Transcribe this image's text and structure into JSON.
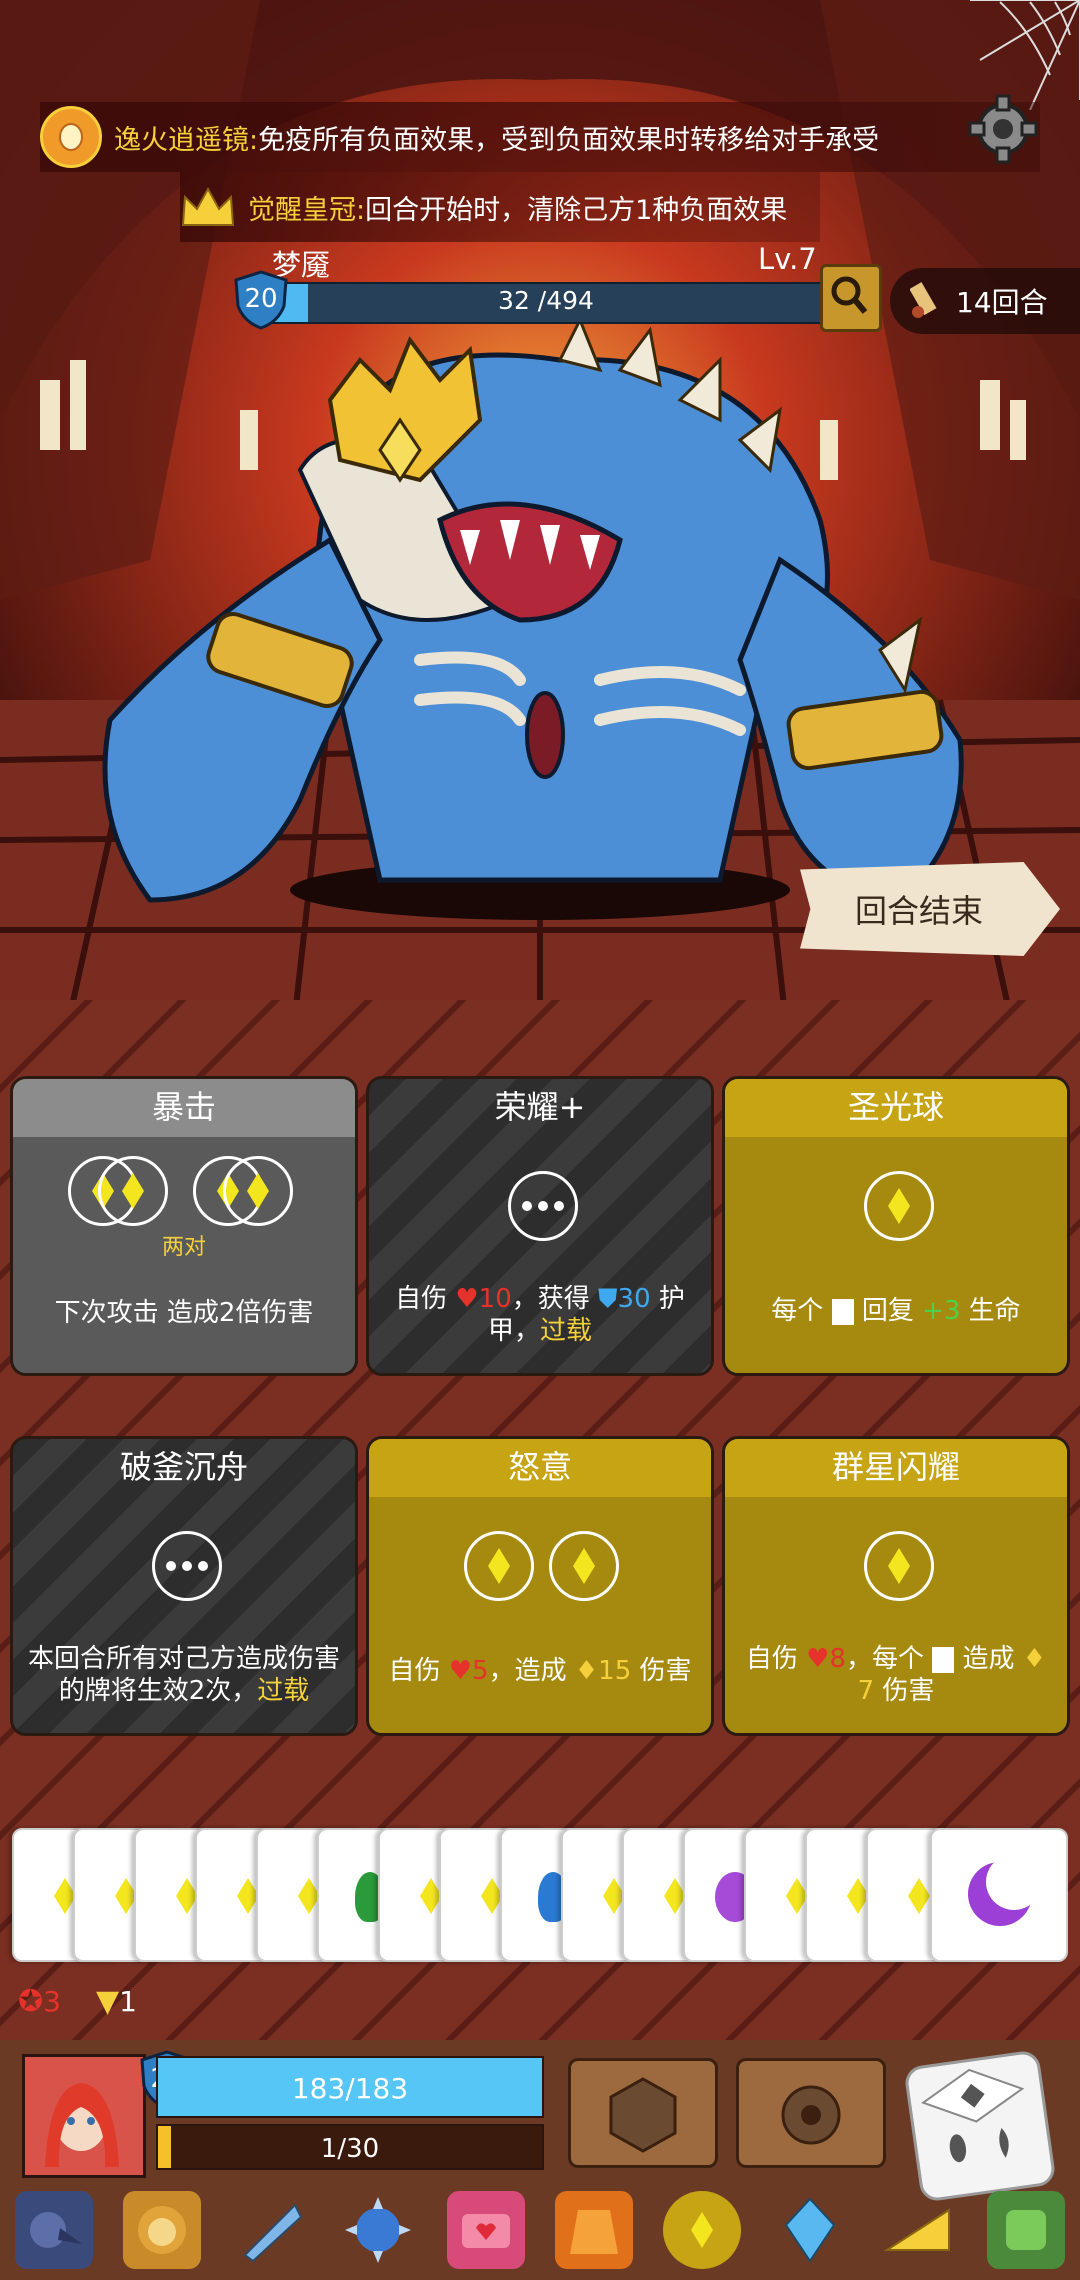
{
  "buffs": [
    {
      "name": "逸火逍遥镜:",
      "desc": "免疫所有负面效果，受到负面效果时转移给对手承受"
    },
    {
      "name": "觉醒皇冠:",
      "desc": "回合开始时，清除己方1种负面效果"
    }
  ],
  "enemy": {
    "name": "梦魇",
    "level": "Lv.7",
    "shield": "20",
    "hp_text": "32 /494",
    "hp_fraction": 0.065
  },
  "turns": "14回合",
  "end_turn_label": "回合结束",
  "cards": [
    {
      "title": "暴击",
      "style": "gray",
      "sublabel": "两对",
      "desc": "下次攻击 造成2倍伤害"
    },
    {
      "title": "荣耀+",
      "style": "dark",
      "desc_parts": [
        "自伤 ",
        "10",
        "，获得 ",
        "30",
        " 护甲，",
        "过载"
      ]
    },
    {
      "title": "圣光球",
      "style": "gold",
      "desc_parts": [
        "每个 ",
        " 回复 ",
        "+3",
        " 生命"
      ]
    },
    {
      "title": "破釜沉舟",
      "style": "dark",
      "desc_parts": [
        "本回合所有对己方造成伤害的牌将生效2次，",
        "过载"
      ]
    },
    {
      "title": "怒意",
      "style": "gold",
      "desc_parts": [
        "自伤 ",
        "5",
        "，造成 ",
        "15",
        " 伤害"
      ]
    },
    {
      "title": "群星闪耀",
      "style": "gold",
      "desc_parts": [
        "自伤 ",
        "8",
        "，每个 ",
        " 造成 ",
        "7",
        " 伤害"
      ]
    }
  ],
  "status": {
    "burn": "3",
    "curse": "1"
  },
  "player": {
    "shield": "22",
    "hp_text": "183/183",
    "hp_fraction": 1.0,
    "exp_text": "1/30",
    "exp_fraction": 0.033
  },
  "colors": {
    "gold": "#f5d03a",
    "hp": "#4fb9f2",
    "damage": "#e5322b",
    "armor": "#3fa8ee",
    "heal": "#4dd04a"
  },
  "relic_icons": [
    "plague-mask-icon",
    "lion-icon",
    "blade-icon",
    "spiked-shield-icon",
    "heart-chest-icon",
    "robe-icon",
    "diamond-medal-icon",
    "crystal-icon",
    "cheese-icon",
    "green-scroll-icon"
  ]
}
